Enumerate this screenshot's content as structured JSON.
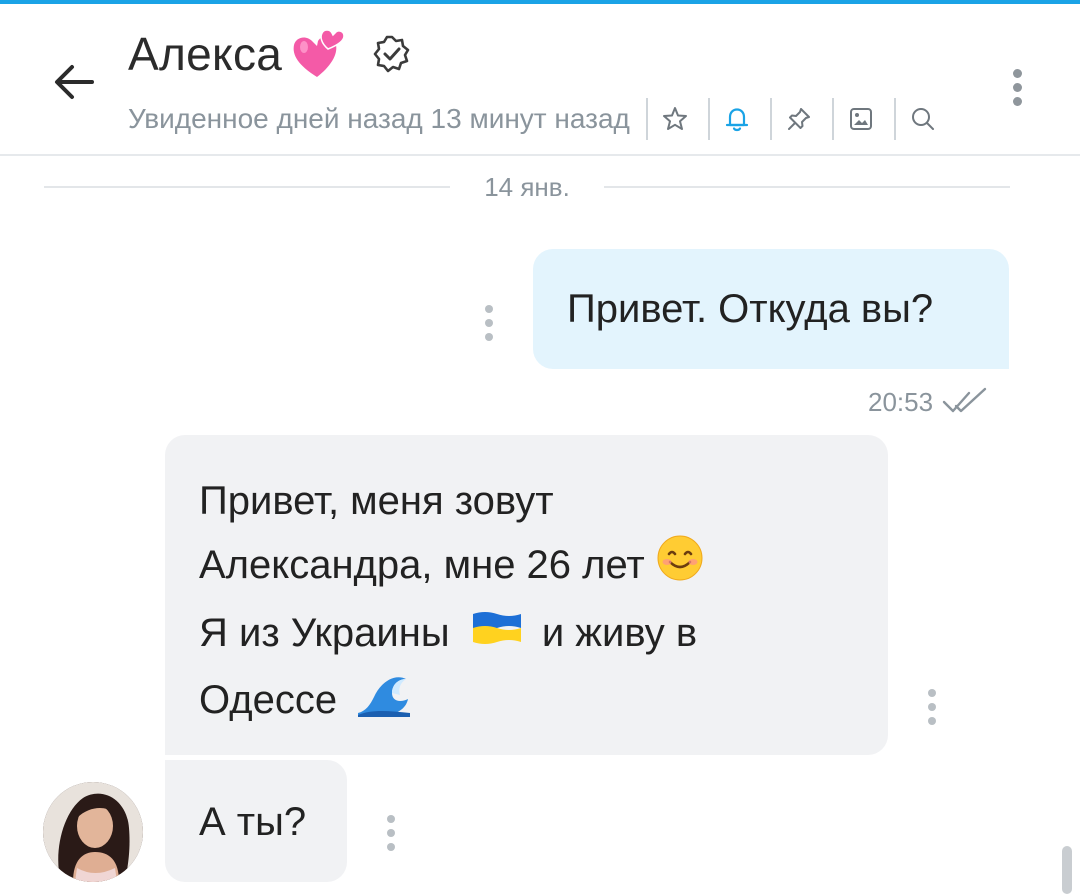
{
  "header": {
    "title": "Алекса",
    "title_emoji": "two-hearts-emoji",
    "verified_icon": "verified-badge-icon",
    "subtitle": "Увиденное дней назад 13 минут назад",
    "actions": [
      {
        "name": "star-icon"
      },
      {
        "name": "bell-icon",
        "color": "#1aa3e6"
      },
      {
        "name": "pin-icon"
      },
      {
        "name": "image-icon"
      },
      {
        "name": "search-icon"
      }
    ],
    "accent_color": "#1aa3e6"
  },
  "chat": {
    "date_divider": "14 янв.",
    "messages": [
      {
        "direction": "outgoing",
        "lines": [
          "Привет. Откуда вы?"
        ],
        "time": "20:53",
        "status_icon": "double-check-icon"
      },
      {
        "direction": "incoming",
        "lines": [
          "Привет, меня зовут",
          "Александра, мне 26 лет",
          "Я из Украины",
          "и живу в",
          "Одессе"
        ],
        "emojis": [
          "smiling-face-emoji",
          "ukraine-flag-emoji",
          "water-wave-emoji"
        ]
      },
      {
        "direction": "incoming",
        "lines": [
          "А ты?"
        ]
      }
    ]
  },
  "colors": {
    "outgoing_bubble": "#e3f4fd",
    "incoming_bubble": "#f1f2f4",
    "muted_text": "#8a949c"
  }
}
